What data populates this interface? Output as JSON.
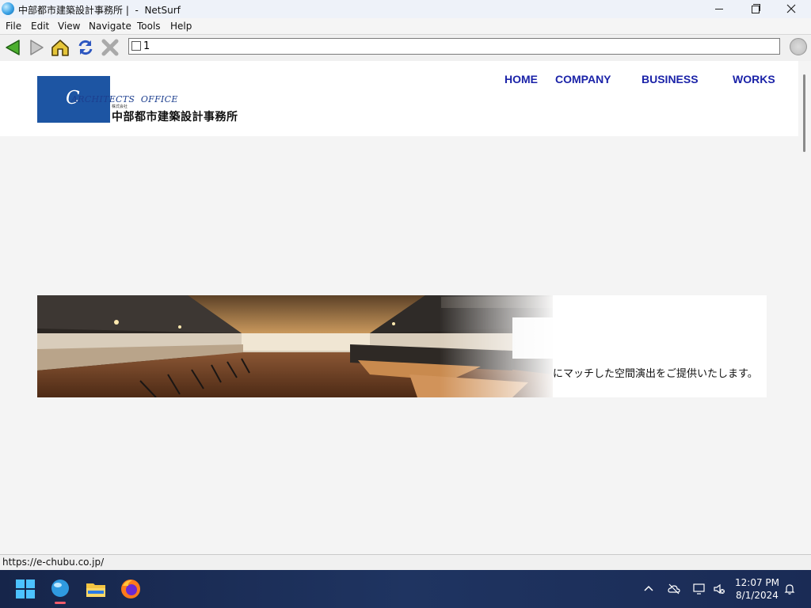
{
  "window": {
    "title": "中部都市建築設計事務所 |  -  NetSurf",
    "controls": {
      "minimize": "minimize",
      "maximize": "restore",
      "close": "close"
    }
  },
  "menu": {
    "items": [
      "File",
      "Edit",
      "View",
      "Navigate",
      "Tools",
      "Help"
    ]
  },
  "toolbar": {
    "buttons": [
      "back-icon",
      "forward-icon",
      "home-icon",
      "reload-icon",
      "stop-icon"
    ],
    "url_value": "1"
  },
  "site": {
    "logo": {
      "mark": "C",
      "text": "ARCHITECTS  OFFICE",
      "kabushiki": "株式会社",
      "name": "中部都市建築設計事務所"
    },
    "nav": [
      "HOME",
      "COMPANY",
      "BUSINESS",
      "WORKS"
    ],
    "hero_text": "にマッチした空間演出をご提供いたします。"
  },
  "status": {
    "text": "https://e-chubu.co.jp/"
  },
  "taskbar": {
    "time": "12:07 PM",
    "date": "8/1/2024",
    "apps": [
      "windows-start-icon",
      "netsurf-icon",
      "file-explorer-icon",
      "firefox-icon"
    ],
    "tray": [
      "chevron-up-icon",
      "cloud-off-icon",
      "display-icon",
      "volume-muted-icon",
      "notification-bell-icon"
    ]
  },
  "colors": {
    "nav_link": "#1b23a8",
    "logo_blue": "#1d55a3",
    "taskbar": "#1b2d58"
  }
}
